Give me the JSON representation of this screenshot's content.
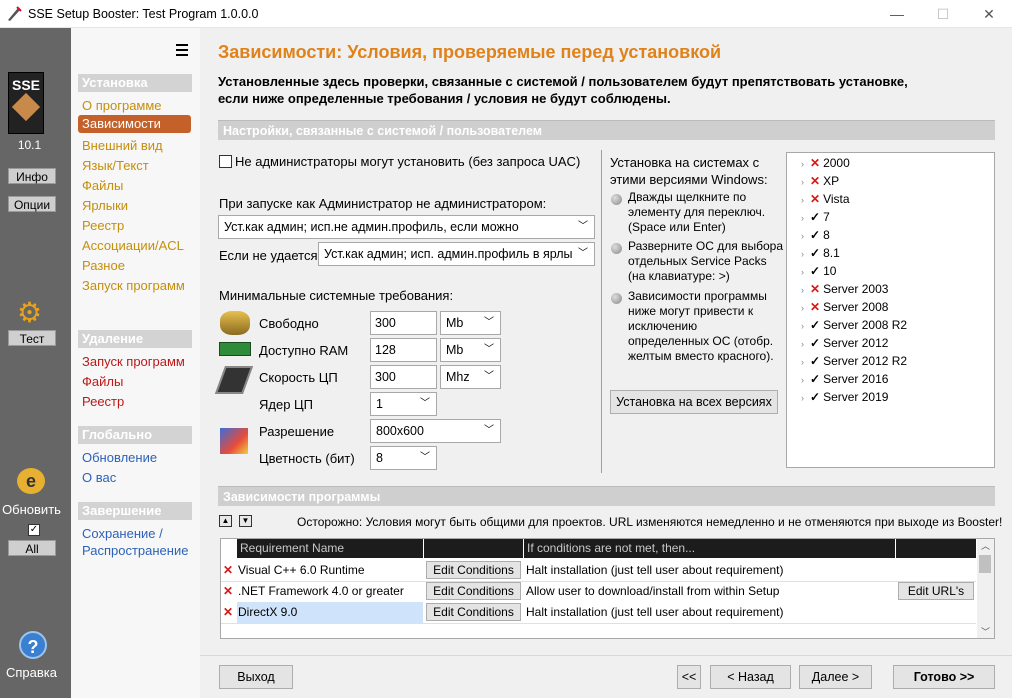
{
  "window": {
    "title": "SSE Setup Booster: Test Program 1.0.0.0",
    "minimize": "—",
    "maximize": "☐",
    "close": "✕"
  },
  "leftbar": {
    "logo": "SSE",
    "version": "10.1",
    "info": "Инфо",
    "options": "Опции",
    "test": "Тест",
    "update": "Обновить",
    "all": "All",
    "help": "Справка"
  },
  "nav": {
    "install_header": "Установка",
    "install_items": [
      "О программе",
      "Зависимости",
      "Внешний вид",
      "Язык/Текст",
      "Файлы",
      "Ярлыки",
      "Реестр",
      "Ассоциации/ACL",
      "Разное",
      "Запуск программ"
    ],
    "remove_header": "Удаление",
    "remove_items": [
      "Запуск программ",
      "Файлы",
      "Реестр"
    ],
    "global_header": "Глобально",
    "global_items": [
      "Обновление",
      "О вас"
    ],
    "finish_header": "Завершение",
    "finish_items": [
      "Сохранение /",
      "Распространение"
    ]
  },
  "page": {
    "title": "Зависимости: Условия, проверяемые перед установкой",
    "desc1": "Установленные здесь проверки, связанные с системой / пользователем будут препятствовать установке,",
    "desc2": "если ниже определенные требования / условия не будут соблюдены."
  },
  "sys": {
    "header": "Настройки, связанные с системой / пользователем",
    "nonadmin": "Не администраторы могут установить (без запроса UAC)",
    "nonadmin_checked": false,
    "run_label": "При запуске как Администратор не администратором:",
    "run_value": "Уст.как админ; исп.не админ.профиль, если можно",
    "fail_label": "Если не удается",
    "fail_value": "Уст.как админ; исп. админ.профиль в ярлы",
    "min_req": "Минимальные системные требования:",
    "free_label": "Свободно",
    "free_value": "300",
    "free_unit": "Mb",
    "ram_label": "Доступно RAM",
    "ram_value": "128",
    "ram_unit": "Mb",
    "cpu_label": "Скорость ЦП",
    "cpu_value": "300",
    "cpu_unit": "Mhz",
    "cores_label": "Ядер ЦП",
    "cores_value": "1",
    "res_label": "Разрешение",
    "res_value": "800x600",
    "color_label": "Цветность (бит)",
    "color_value": "8"
  },
  "versions": {
    "title1": "Установка на системах с",
    "title2": "этими версиями Windows:",
    "hint1": [
      "Дважды щелкните по",
      "элементу для переключ.",
      "(Space или Enter)"
    ],
    "hint2": [
      "Разверните ОС для выбора",
      "отдельных Service Packs",
      "(на клавиатуре: >)"
    ],
    "hint3": [
      "Зависимости программы",
      "ниже могут привести к",
      "исключению",
      "определенных ОС (отобр.",
      "желтым вместо красного)."
    ],
    "all_button": "Установка на всех версиях",
    "items": [
      {
        "name": "2000",
        "state": "✕"
      },
      {
        "name": "XP",
        "state": "✕"
      },
      {
        "name": "Vista",
        "state": "✕"
      },
      {
        "name": "7",
        "state": "✓"
      },
      {
        "name": "8",
        "state": "✓"
      },
      {
        "name": "8.1",
        "state": "✓"
      },
      {
        "name": "10",
        "state": "✓"
      },
      {
        "name": "Server 2003",
        "state": "✕"
      },
      {
        "name": "Server 2008",
        "state": "✕"
      },
      {
        "name": "Server 2008 R2",
        "state": "✓"
      },
      {
        "name": "Server 2012",
        "state": "✓"
      },
      {
        "name": "Server 2012 R2",
        "state": "✓"
      },
      {
        "name": "Server 2016",
        "state": "✓"
      },
      {
        "name": "Server 2019",
        "state": "✓"
      }
    ]
  },
  "deps": {
    "header": "Зависимости программы",
    "warning": "Осторожно: Условия могут быть общими для проектов. URL изменяются немедленно и не отменяются при выходе из Booster!",
    "col_name": "Requirement Name",
    "col_action": "If conditions are not met, then...",
    "edit_label": "Edit Conditions",
    "url_label": "Edit URL's",
    "rows": [
      {
        "name": "Visual C++ 6.0 Runtime",
        "action": "Halt installation (just tell user about requirement)"
      },
      {
        "name": ".NET Framework 4.0 or greater",
        "action": "Allow user to download/install from within Setup"
      },
      {
        "name": "DirectX 9.0",
        "action": "Halt installation (just tell user about requirement)"
      }
    ]
  },
  "footer": {
    "exit": "Выход",
    "first": "<<",
    "back": "< Назад",
    "next": "Далее >",
    "done": "Готово >>"
  }
}
